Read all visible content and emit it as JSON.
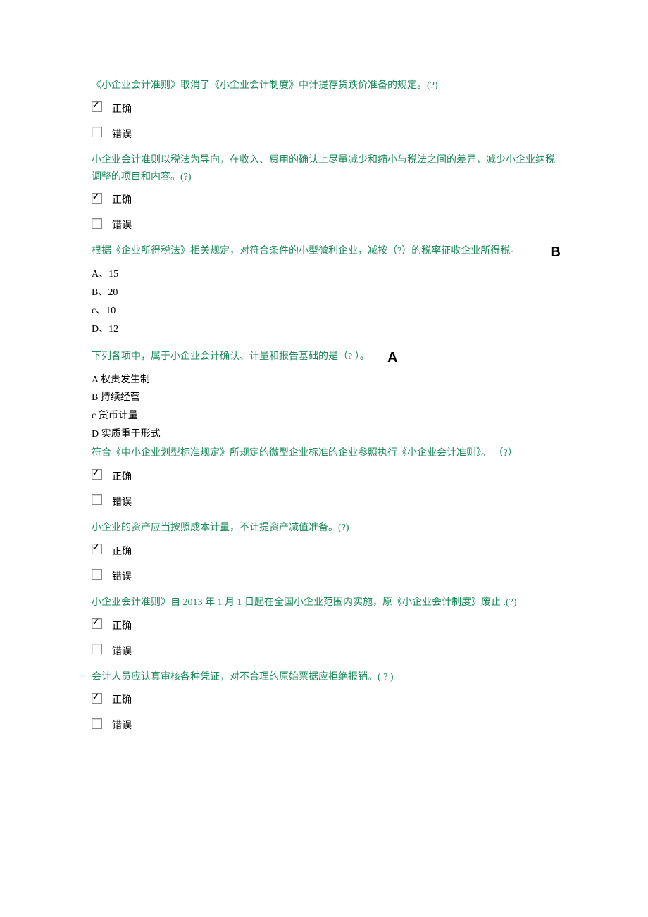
{
  "labels": {
    "correct": "正确",
    "wrong": "错误"
  },
  "q1": {
    "text": "《小企业会计准则》取消了《小企业会计制度》中计提存货跌价准备的规定。(?)"
  },
  "q2": {
    "text": "小企业会计准则以税法为导向，在收入、费用的确认上尽量减少和缩小与税法之间的差异，减少小企业纳税调整的项目和内容。(?)"
  },
  "q3": {
    "text": "根据《企业所得税法》相关规定，对符合条件的小型微利企业，减按（?）的税率征收企业所得税。",
    "answer": "B",
    "a": "A、15",
    "b": "B、20",
    "c": "c、10",
    "d": "D、12"
  },
  "q4": {
    "text": "下列各项中，属于小企业会计确认、计量和报告基础的是（? ）。",
    "answer": "A",
    "a": "A  权责发生制",
    "b": "B  持续经营",
    "c": "c  货币计量",
    "d": "D  实质重于形式"
  },
  "q5": {
    "text": "符合《中小企业划型标准规定》所规定的微型企业标准的企业参照执行《小企业会计准则》。 （?）"
  },
  "q6": {
    "text": "小企业的资产应当按照成本计量，不计提资产减值准备。(?)"
  },
  "q7": {
    "text_a": "小企业会计准则》自 ",
    "text_b": "2013",
    "text_c": " 年 ",
    "text_d": "1",
    "text_e": " 月 ",
    "text_f": "1",
    "text_g": " 日起在全国小企业范围内实施，原《小企业会计制度》废止 .(?)"
  },
  "q8": {
    "text": "会计人员应认真审核各种凭证，对不合理的原始票据应拒绝报销。( ? )"
  }
}
